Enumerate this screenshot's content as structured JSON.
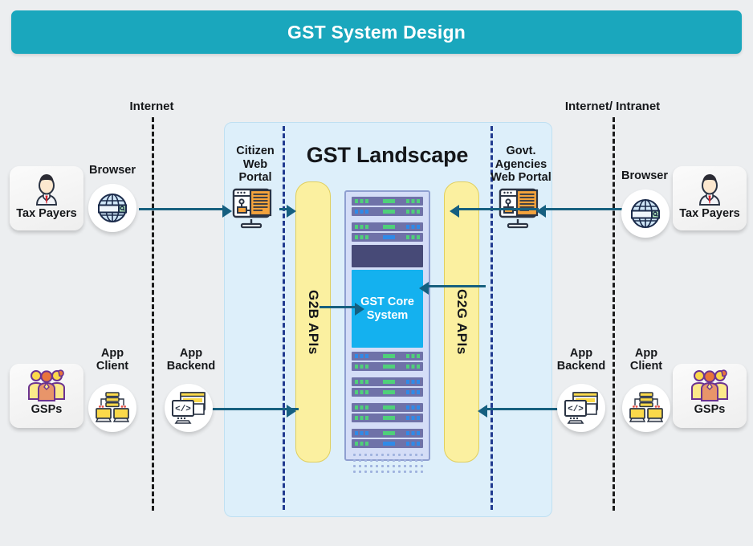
{
  "header": {
    "title": "GST System Design"
  },
  "colors": {
    "header_teal": "#1aa7bd",
    "panel_blue": "#ddeffa",
    "api_yellow": "#fbf0a0",
    "core_cyan": "#14b1ef",
    "arrow_blue": "#155f80",
    "page_bg": "#eceef0",
    "navy_dash": "#203a8f",
    "dark_dash": "#1b1b1b"
  },
  "zones": {
    "left_boundary_label": "Internet",
    "right_boundary_label": "Internet/ Intranet"
  },
  "landscape": {
    "title": "GST Landscape",
    "citizen_portal_label": "Citizen\nWeb\nPortal",
    "citizen_portal_lines": [
      "Citizen",
      "Web",
      "Portal"
    ],
    "govt_portal_lines": [
      "Govt.",
      "Agencies",
      "Web Portal"
    ],
    "g2b_label": "G2B APIs",
    "g2g_label": "G2G APIs",
    "core_label": "GST Core\nSystem",
    "core_lines": [
      "GST Core",
      "System"
    ]
  },
  "left_actors": {
    "taxpayers": {
      "label": "Tax Payers",
      "icon": "user-icon"
    },
    "browser": {
      "label": "Browser",
      "icon": "globe-browser-icon"
    },
    "gsps": {
      "label": "GSPs",
      "icon": "user-group-icon"
    },
    "app_client": {
      "label": "App\nClient",
      "lines": [
        "App",
        "Client"
      ],
      "icon": "app-client-icon"
    },
    "app_backend": {
      "label": "App\nBackend",
      "lines": [
        "App",
        "Backend"
      ],
      "icon": "app-backend-icon"
    }
  },
  "right_actors": {
    "taxpayers": {
      "label": "Tax Payers",
      "icon": "user-icon"
    },
    "browser": {
      "label": "Browser",
      "icon": "globe-browser-icon"
    },
    "gsps": {
      "label": "GSPs",
      "icon": "user-group-icon"
    },
    "app_client": {
      "label": "App\nClient",
      "lines": [
        "App",
        "Client"
      ],
      "icon": "app-client-icon"
    },
    "app_backend": {
      "label": "App\nBackend",
      "lines": [
        "App",
        "Backend"
      ],
      "icon": "app-backend-icon"
    }
  }
}
